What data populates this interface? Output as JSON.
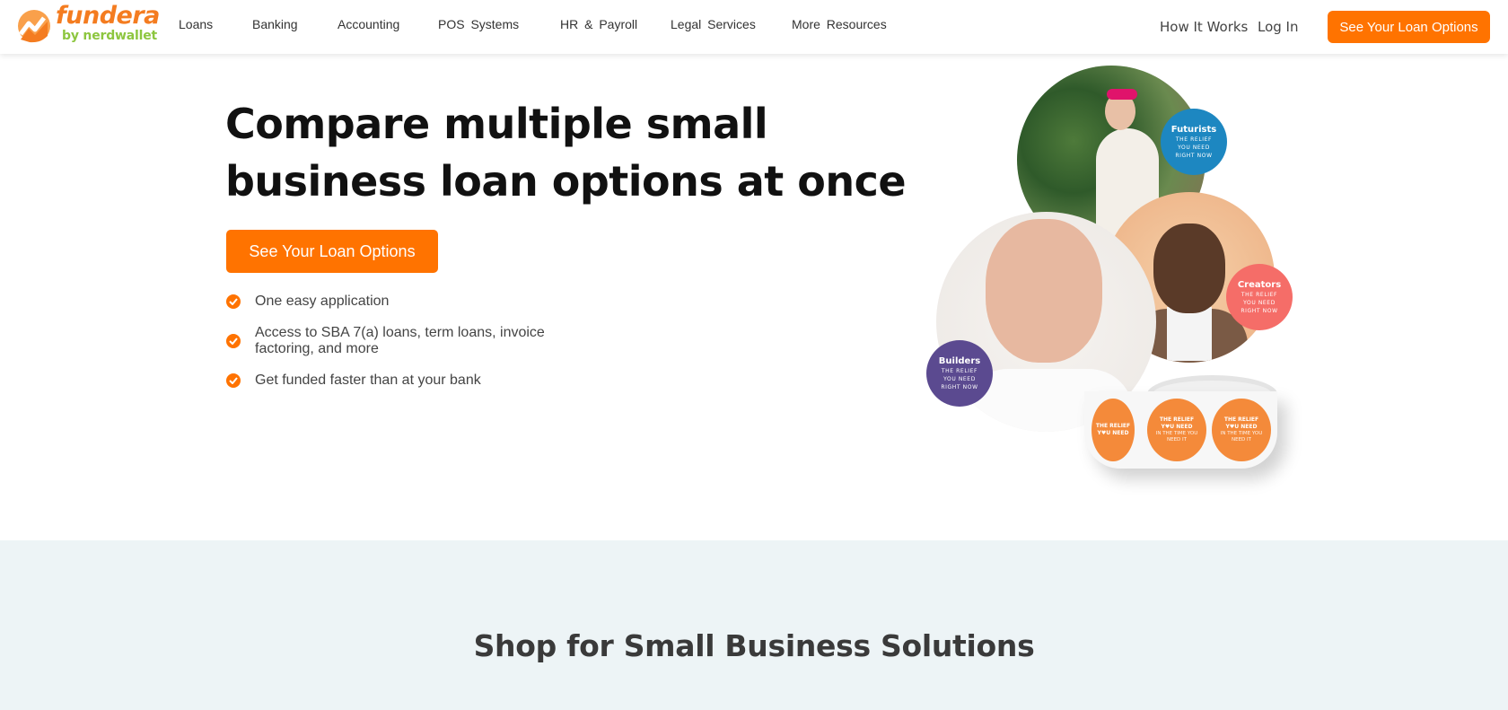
{
  "brand": {
    "name": "fundera",
    "tagline": "by nerdwallet",
    "accent_color": "#ff7300",
    "logo_orange": "#f47c20",
    "logo_green": "#8dc63f"
  },
  "nav": {
    "items": [
      {
        "label": "Loans"
      },
      {
        "label": "Banking"
      },
      {
        "label": "Accounting"
      },
      {
        "label": "POS Systems"
      },
      {
        "label": "HR & Payroll"
      },
      {
        "label": "Legal Services"
      },
      {
        "label": "More Resources"
      }
    ],
    "how_it_works": "How It Works",
    "log_in": "Log In",
    "cta": "See Your Loan Options"
  },
  "hero": {
    "title_line1": "Compare multiple small",
    "title_line2": "business loan options at once",
    "cta": "See Your Loan Options",
    "benefits": [
      {
        "text": "One easy application"
      },
      {
        "text": "Access to SBA 7(a) loans, term loans, invoice factoring, and more"
      },
      {
        "text": "Get funded faster than at your bank"
      }
    ],
    "collage": {
      "badges": [
        {
          "title": "Futurists",
          "subtitle": "THE RELIEF YOU NEED RIGHT NOW",
          "color": "#1d87c1"
        },
        {
          "title": "Creators",
          "subtitle": "THE RELIEF YOU NEED RIGHT NOW",
          "color": "#f56d68"
        },
        {
          "title": "Builders",
          "subtitle": "THE RELIEF YOU NEED RIGHT NOW",
          "color": "#5b4a90"
        }
      ],
      "sticker": {
        "line1": "THE RELIEF Y♥U NEED",
        "line2": "IN THE TIME YOU NEED IT"
      }
    }
  },
  "solutions": {
    "title": "Shop for Small Business Solutions"
  }
}
